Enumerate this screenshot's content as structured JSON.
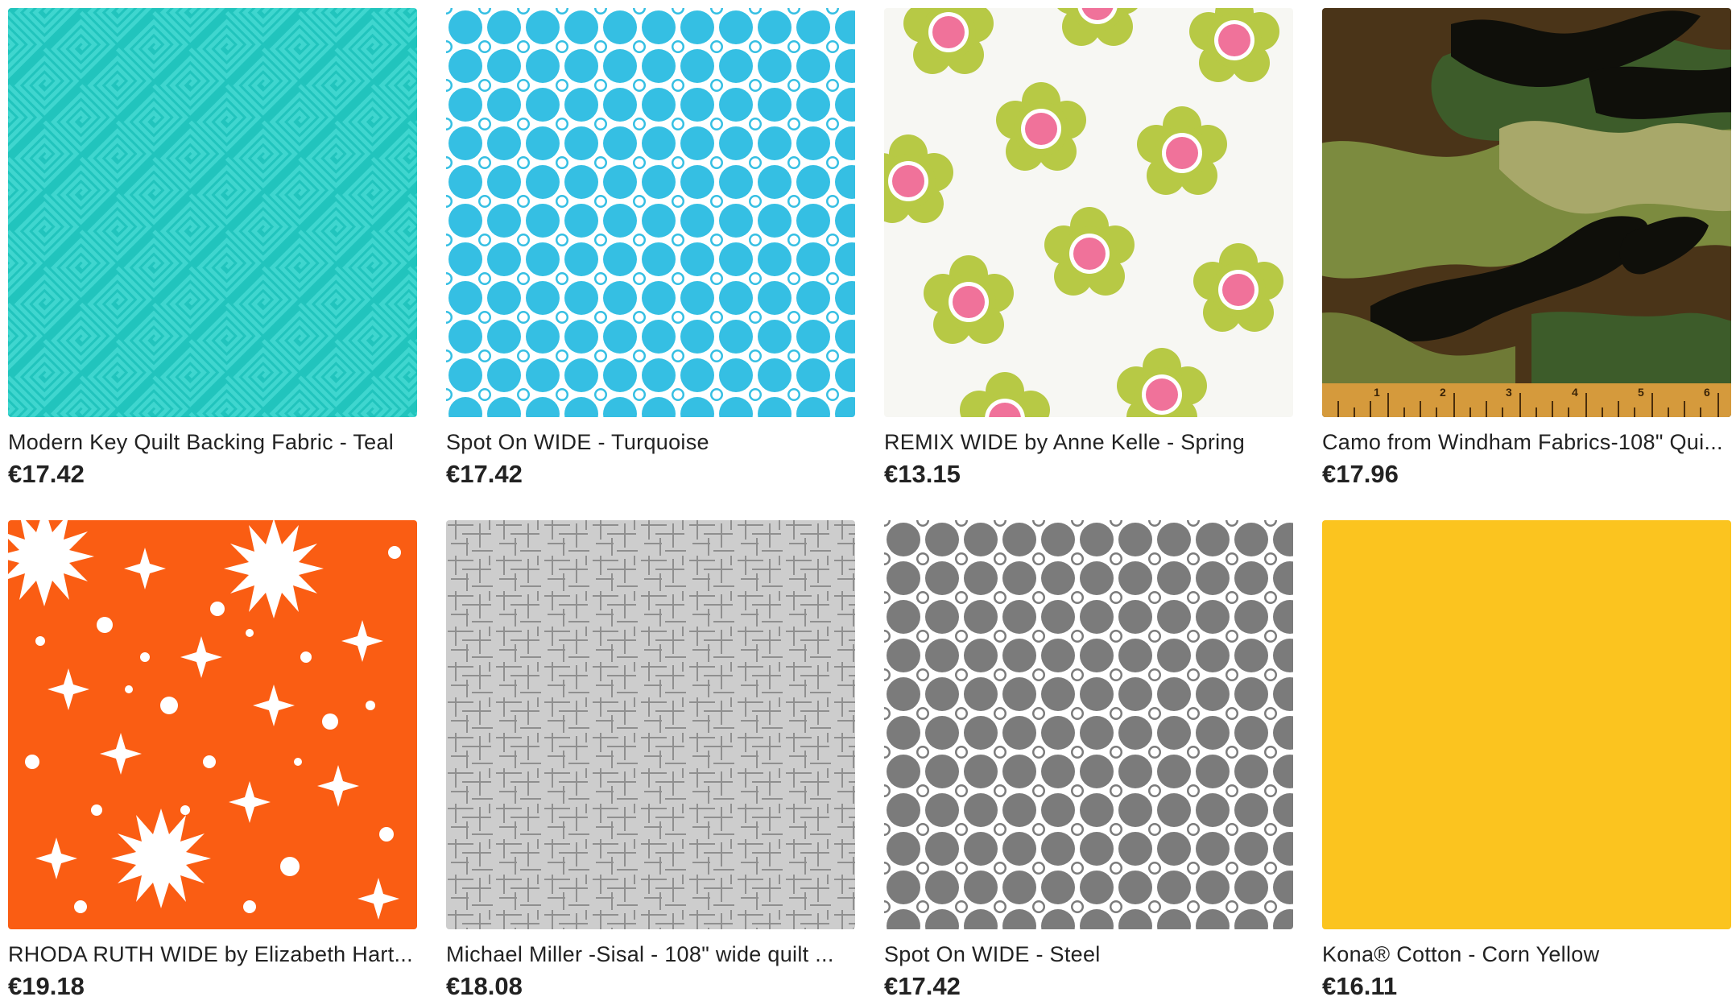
{
  "listings": [
    {
      "title": "Modern Key Quilt Backing Fabric - Teal",
      "price": "€17.42",
      "swatch": "teal greek-key geometric pattern"
    },
    {
      "title": "Spot On WIDE - Turquoise",
      "price": "€17.42",
      "swatch": "turquoise dots with white rings"
    },
    {
      "title": "REMIX WIDE by Anne Kelle - Spring",
      "price": "€13.15",
      "swatch": "lime green daisies with pink centers on white"
    },
    {
      "title": "Camo from Windham Fabrics-108\" Qui...",
      "price": "€17.96",
      "swatch": "green brown black camouflage with ruler"
    },
    {
      "title": "RHODA RUTH WIDE by Elizabeth Hart...",
      "price": "€19.18",
      "swatch": "orange with white stars and dots"
    },
    {
      "title": "Michael Miller -Sisal - 108\" wide quilt ...",
      "price": "€18.08",
      "swatch": "light grey crosshatch texture"
    },
    {
      "title": "Spot On WIDE - Steel",
      "price": "€17.42",
      "swatch": "grey dots with white rings"
    },
    {
      "title": "Kona® Cotton - Corn Yellow",
      "price": "€16.11",
      "swatch": "solid corn yellow"
    }
  ],
  "colors": {
    "teal": "#21c4bd",
    "turquoise": "#35bfe3",
    "lime": "#b7c945",
    "pink": "#f0729a",
    "orange": "#fa5d13",
    "sisal": "#c9c9c9",
    "steel": "#7b7b7b",
    "corn_yellow": "#fbc41f"
  }
}
